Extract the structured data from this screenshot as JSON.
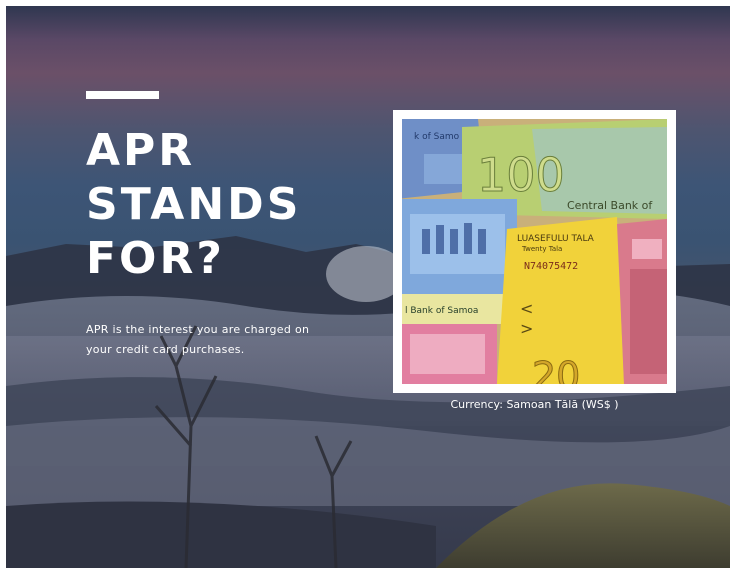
{
  "slide": {
    "headline_lines": [
      "APR",
      "STANDS",
      "FOR?"
    ],
    "body": "APR is the interest you are charged on your credit card purchases.",
    "image": {
      "caption": "Currency: Samoan Tālā (WS$ )",
      "note_texts": {
        "denomination_100": "100",
        "central_bank": "Central Bank of",
        "bank_of_samoa_top": "k of Samo",
        "bank_of_samoa_mid": "l Bank of Samoa",
        "luaseululu": "LUASEFULU TALA",
        "twenty_tala": "Twenty Tala",
        "serial": "N74075472",
        "denomination_20": "20"
      }
    }
  }
}
